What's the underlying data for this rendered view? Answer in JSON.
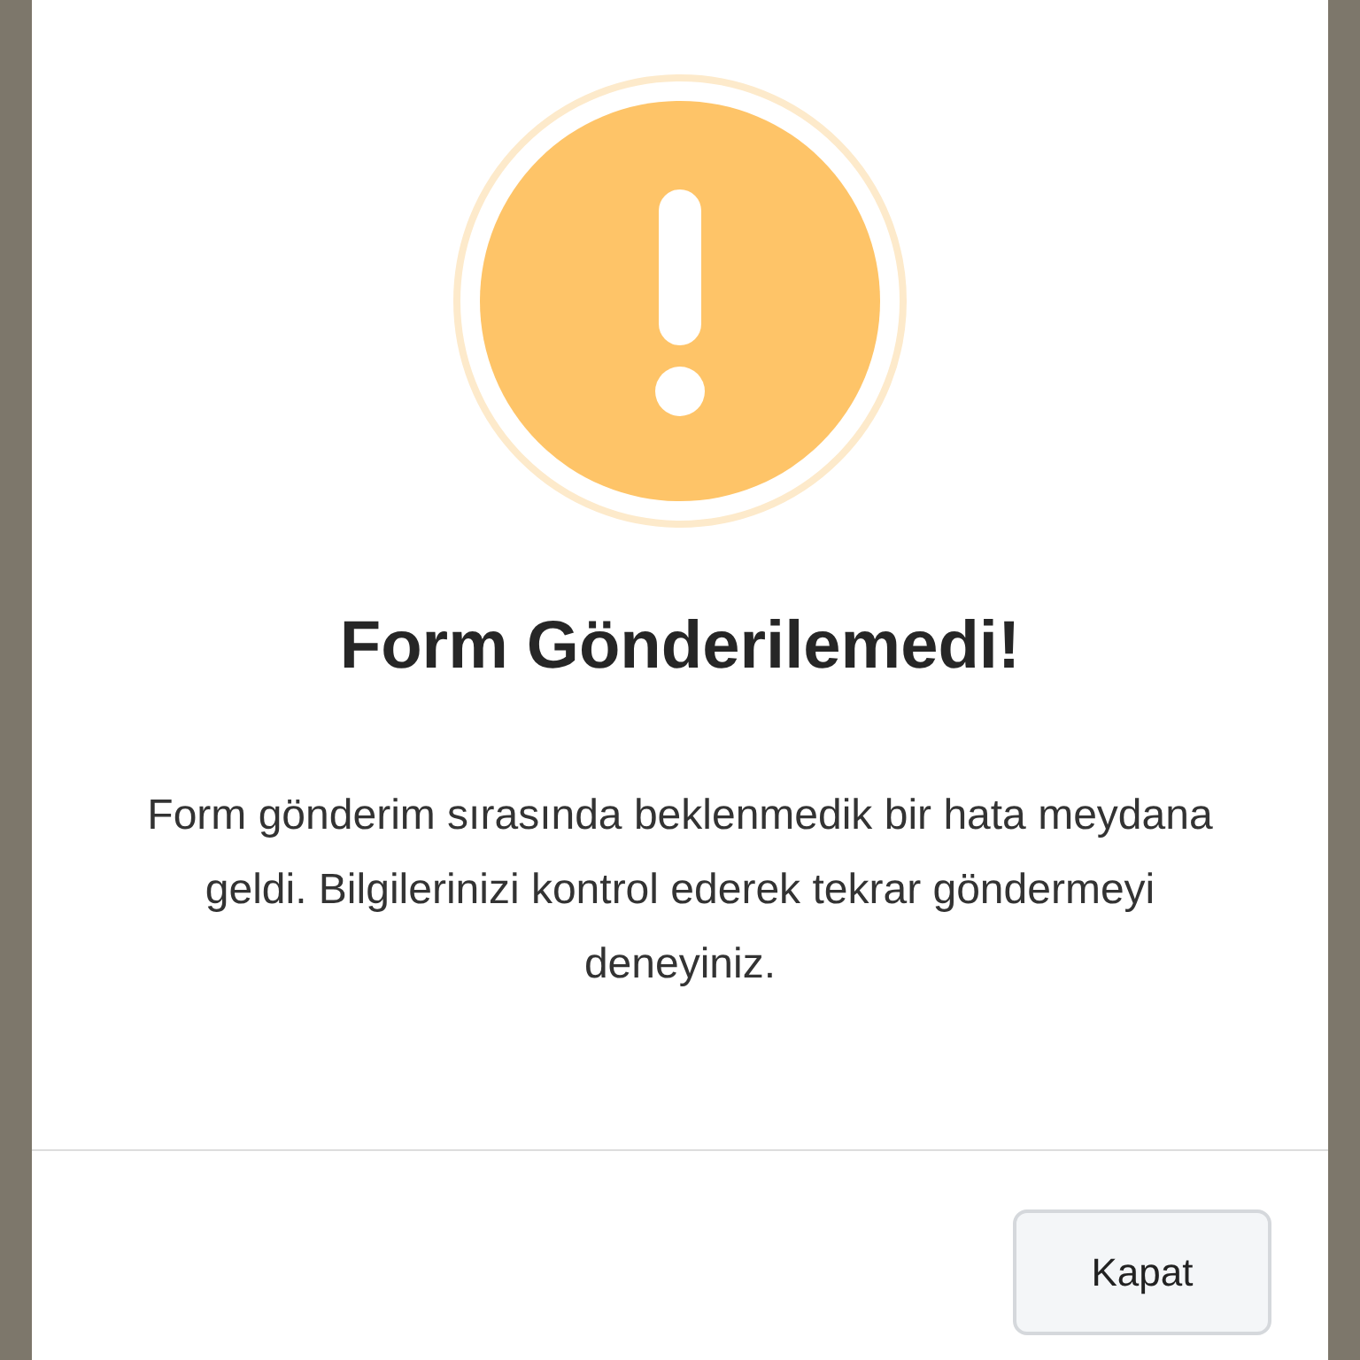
{
  "dialog": {
    "title": "Form Gönderilemedi!",
    "message": "Form gönderim sırasında beklenmedik bir hata meydana geldi. Bilgilerinizi kontrol ederek tekrar göndermeyi deneyiniz.",
    "buttons": [
      "Kapat"
    ]
  }
}
